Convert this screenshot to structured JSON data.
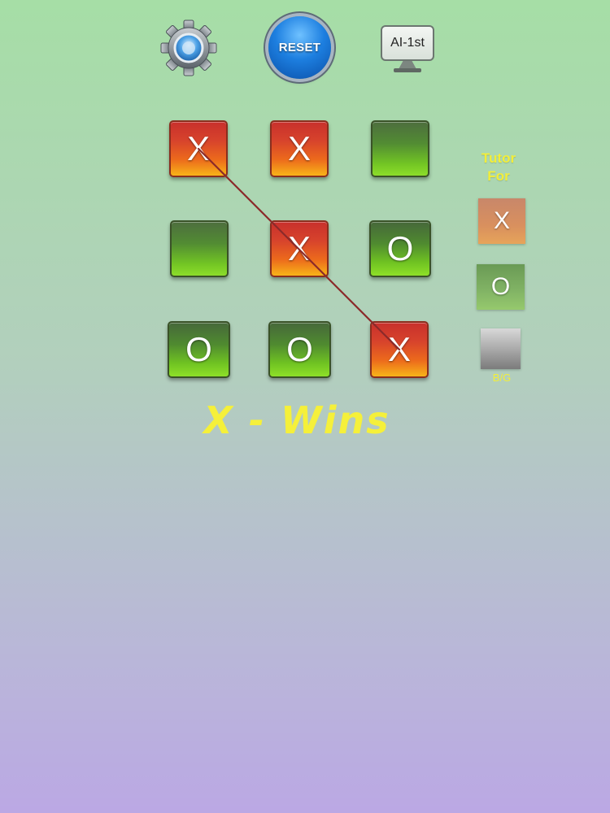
{
  "toolbar": {
    "settings_icon": "gear-icon",
    "reset_label": "RESET",
    "ai_label": "AI-1st"
  },
  "board": {
    "cells": [
      {
        "mark": "X",
        "state": "x"
      },
      {
        "mark": "X",
        "state": "x"
      },
      {
        "mark": "",
        "state": "empty"
      },
      {
        "mark": "",
        "state": "empty"
      },
      {
        "mark": "X",
        "state": "x"
      },
      {
        "mark": "O",
        "state": "o"
      },
      {
        "mark": "O",
        "state": "o"
      },
      {
        "mark": "O",
        "state": "o"
      },
      {
        "mark": "X",
        "state": "x"
      }
    ],
    "winning_line": "diagonal"
  },
  "result": {
    "text": "X - Wins"
  },
  "tutor": {
    "title_line1": "Tutor",
    "title_line2": "For",
    "option_x": "X",
    "option_o": "O",
    "bg_label": "B/G"
  },
  "colors": {
    "x_tile": "#d7432c",
    "o_tile": "#4f8a30",
    "accent_yellow": "#f5f03a",
    "win_line": "#8b2a2a"
  }
}
